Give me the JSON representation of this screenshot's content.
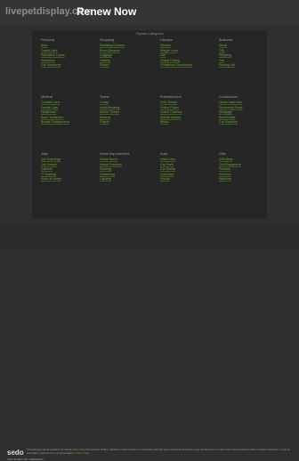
{
  "header": {
    "domain": "livepetdisplay.com",
    "renew_label": "Renew Now"
  },
  "panel": {
    "heading": "Popular Categories"
  },
  "categories": [
    {
      "title": "Personal",
      "links": [
        "Auto",
        "Credit Card",
        "Education Loans",
        "Insurance",
        "Car Insurance"
      ]
    },
    {
      "title": "Shopping",
      "links": [
        "Wedding Dresses",
        "Prom Dresses",
        "Luggage",
        "Jewelry",
        "Shoes"
      ]
    },
    {
      "title": "Lifestyle",
      "links": [
        "Fitness",
        "Weight Loss",
        "Diet",
        "Online Dating",
        "Christmas Decorations"
      ]
    },
    {
      "title": "Business",
      "links": [
        "Stock",
        "DSL",
        "Shipping",
        "Fax",
        "Printing Ink"
      ]
    },
    {
      "title": "Medical",
      "links": [
        "Contact Lens",
        "Dental Care",
        "Healthcare",
        "Acne Treatment",
        "Breast Enlargement"
      ]
    },
    {
      "title": "Travel",
      "links": [
        "Cruise",
        "Hotel Booking",
        "Airline Tickets",
        "Airfares",
        "Flights"
      ]
    },
    {
      "title": "Entertainment",
      "links": [
        "DVD Rental",
        "Online Poker",
        "Online Casinos",
        "Mobile Games",
        "Music"
      ]
    },
    {
      "title": "Construction",
      "links": [
        "Home Insurance",
        "Swimming Pools",
        "Mortgage",
        "Real Estate",
        "Car Payment"
      ]
    },
    {
      "title": "Jobs",
      "links": [
        "Job Openings",
        "Job Search",
        "Careers",
        "IT Training",
        "Work at Home"
      ]
    },
    {
      "title": "Home Improvement",
      "links": [
        "Home Decor",
        "Home Furniture",
        "Flooring",
        "Gardening",
        "Lighting"
      ]
    },
    {
      "title": "Auto",
      "links": [
        "Used Cars",
        "Car Parts",
        "Car Rental",
        "Chevrolet",
        "Honda"
      ]
    },
    {
      "title": "Gifts",
      "links": [
        "Gift Ideas",
        "Golf Equipment",
        "Flowers",
        "Perfume",
        "Watches"
      ]
    }
  ],
  "footer": {
    "sedo_brand": "sedo",
    "sedo_tagline": "Your domain. Our marketplace.",
    "disclaimer": "This webpage was generated by the domain owner using Sedo Domain Parking. Disclaimer: Sedo maintains no relationship with third party advertisers. Reference to any specific service or trade mark is not controlled by Sedo nor does it constitute or imply its association, endorsement or recommendation.",
    "disclaimer_link": "Privacy Policy"
  },
  "colors": {
    "background": "#2f2f2f",
    "panel": "#262626",
    "link": "#6fa336",
    "heading": "#9c9c9c",
    "renew": "#ffffff"
  }
}
